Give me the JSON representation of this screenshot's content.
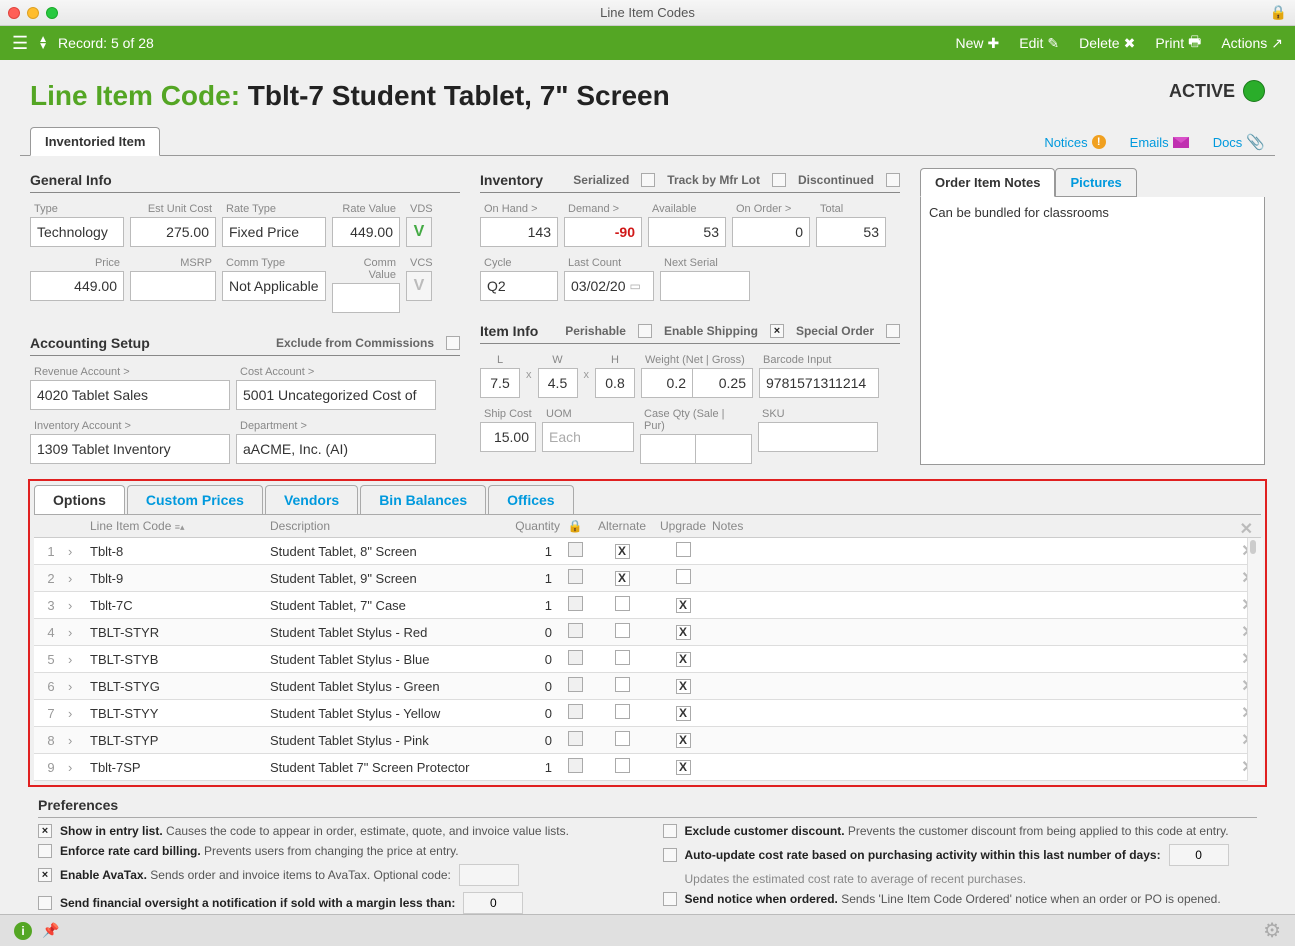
{
  "titlebar": {
    "title": "Line Item Codes"
  },
  "toolbar": {
    "record": "Record:  5 of 28",
    "new": "New",
    "edit": "Edit",
    "delete": "Delete",
    "print": "Print",
    "actions": "Actions"
  },
  "page": {
    "label": "Line Item Code:",
    "name": "Tblt-7 Student Tablet, 7\" Screen",
    "status": "ACTIVE",
    "main_tab": "Inventoried Item",
    "links": {
      "notices": "Notices",
      "emails": "Emails",
      "docs": "Docs"
    }
  },
  "general": {
    "head": "General Info",
    "type_lbl": "Type",
    "type": "Technology",
    "cost_lbl": "Est Unit Cost",
    "cost": "275.00",
    "ratetype_lbl": "Rate Type",
    "ratetype": "Fixed Price",
    "rateval_lbl": "Rate Value",
    "rateval": "449.00",
    "vds_lbl": "VDS",
    "vds": "V",
    "price_lbl": "Price",
    "price": "449.00",
    "msrp_lbl": "MSRP",
    "msrp": "",
    "commtype_lbl": "Comm Type",
    "commtype": "Not Applicable",
    "commval_lbl": "Comm Value",
    "commval": "",
    "vcs_lbl": "VCS"
  },
  "accounting": {
    "head": "Accounting Setup",
    "exclude": "Exclude from Commissions",
    "rev_lbl": "Revenue Account >",
    "rev": "4020 Tablet Sales",
    "cost_lbl": "Cost Account >",
    "cost": "5001 Uncategorized Cost of",
    "inv_lbl": "Inventory Account >",
    "inv": "1309 Tablet Inventory",
    "dept_lbl": "Department >",
    "dept": "aACME, Inc.  (AI)"
  },
  "inventory": {
    "head": "Inventory",
    "serialized": "Serialized",
    "trackmfr": "Track by Mfr Lot",
    "disc": "Discontinued",
    "onhand_lbl": "On Hand >",
    "onhand": "143",
    "demand_lbl": "Demand >",
    "demand": "-90",
    "avail_lbl": "Available",
    "avail": "53",
    "onorder_lbl": "On Order >",
    "onorder": "0",
    "total_lbl": "Total",
    "total": "53",
    "cycle_lbl": "Cycle",
    "cycle": "Q2",
    "lastcount_lbl": "Last Count",
    "lastcount": "03/02/20",
    "nextserial_lbl": "Next Serial",
    "nextserial": ""
  },
  "iteminfo": {
    "head": "Item Info",
    "perishable": "Perishable",
    "enableship": "Enable Shipping",
    "specialorder": "Special Order",
    "l_lbl": "L",
    "l": "7.5",
    "w_lbl": "W",
    "w": "4.5",
    "h_lbl": "H",
    "h": "0.8",
    "weight_lbl": "Weight (Net | Gross)",
    "wnet": "0.2",
    "wgross": "0.25",
    "barcode_lbl": "Barcode Input",
    "barcode": "9781571311214",
    "ship_lbl": "Ship Cost",
    "ship": "15.00",
    "uom_lbl": "UOM",
    "uom_ph": "Each",
    "caseqty_lbl": "Case Qty (Sale | Pur)",
    "sku_lbl": "SKU"
  },
  "notes": {
    "tab1": "Order Item Notes",
    "tab2": "Pictures",
    "body": "Can be bundled for classrooms"
  },
  "lowertabs": {
    "options": "Options",
    "custom": "Custom Prices",
    "vendors": "Vendors",
    "bins": "Bin Balances",
    "offices": "Offices",
    "cols": {
      "code": "Line Item Code",
      "desc": "Description",
      "qty": "Quantity",
      "alt": "Alternate",
      "upg": "Upgrade",
      "notes": "Notes"
    }
  },
  "options": [
    {
      "n": "1",
      "code": "Tblt-8",
      "desc": "Student Tablet, 8\" Screen",
      "qty": "1",
      "alt": true,
      "upg": false
    },
    {
      "n": "2",
      "code": "Tblt-9",
      "desc": "Student Tablet, 9\" Screen",
      "qty": "1",
      "alt": true,
      "upg": false
    },
    {
      "n": "3",
      "code": "Tblt-7C",
      "desc": "Student Tablet, 7\" Case",
      "qty": "1",
      "alt": false,
      "upg": true
    },
    {
      "n": "4",
      "code": "TBLT-STYR",
      "desc": "Student Tablet Stylus - Red",
      "qty": "0",
      "alt": false,
      "upg": true
    },
    {
      "n": "5",
      "code": "TBLT-STYB",
      "desc": "Student Tablet Stylus - Blue",
      "qty": "0",
      "alt": false,
      "upg": true
    },
    {
      "n": "6",
      "code": "TBLT-STYG",
      "desc": "Student Tablet Stylus - Green",
      "qty": "0",
      "alt": false,
      "upg": true
    },
    {
      "n": "7",
      "code": "TBLT-STYY",
      "desc": "Student Tablet Stylus - Yellow",
      "qty": "0",
      "alt": false,
      "upg": true
    },
    {
      "n": "8",
      "code": "TBLT-STYP",
      "desc": "Student Tablet Stylus - Pink",
      "qty": "0",
      "alt": false,
      "upg": true
    },
    {
      "n": "9",
      "code": "Tblt-7SP",
      "desc": "Student Tablet 7\" Screen Protector",
      "qty": "1",
      "alt": false,
      "upg": true
    }
  ],
  "prefs": {
    "head": "Preferences",
    "p1b": "Show in entry list.",
    "p1t": " Causes the code to appear in order, estimate, quote, and invoice value lists.",
    "p2b": "Enforce rate card billing.",
    "p2t": " Prevents users from changing the price at entry.",
    "p3b": "Enable AvaTax.",
    "p3t": " Sends order and invoice items to AvaTax. Optional code:",
    "p4b": "Send financial oversight a notification if sold with a margin less than:",
    "p4v": "0",
    "p5b": "Exclude customer discount.",
    "p5t": " Prevents the customer discount from being applied to this code at entry.",
    "p6b": "Auto-update cost rate based on purchasing activity within this last number of days:",
    "p6v": "0",
    "p6t": "Updates the estimated cost rate to average of recent purchases.",
    "p7b": "Send notice when ordered.",
    "p7t": " Sends 'Line Item Code Ordered' notice when an order or PO is opened."
  }
}
